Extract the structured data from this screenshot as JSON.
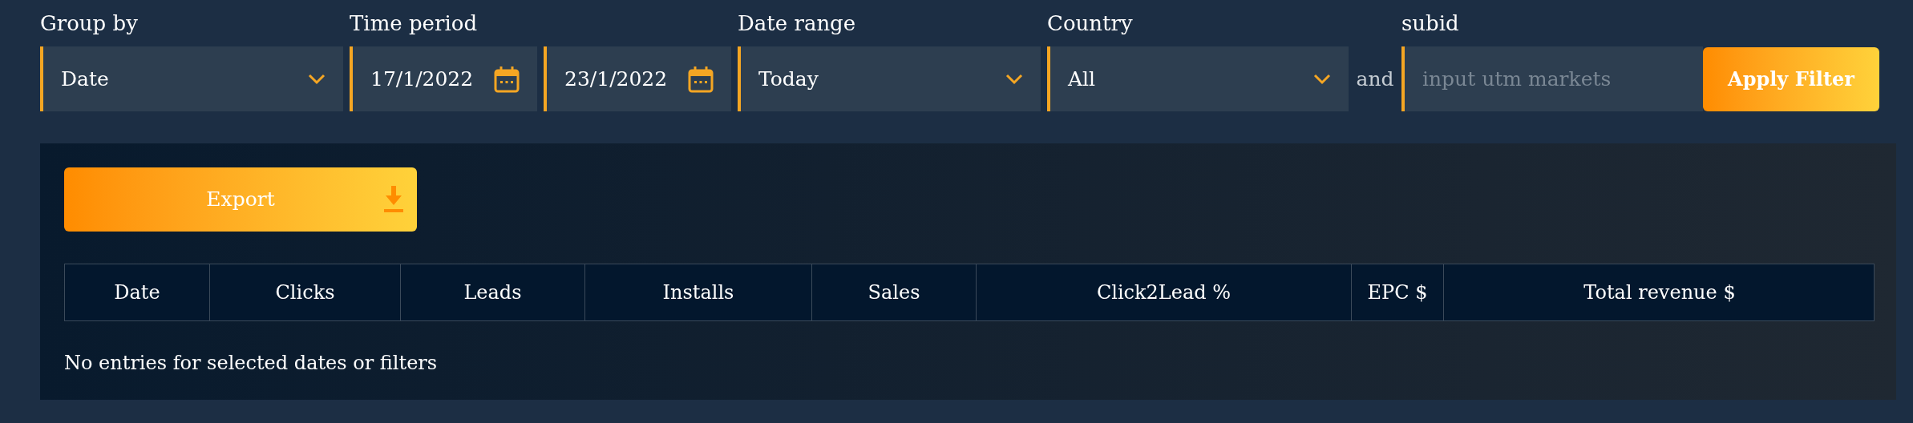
{
  "filters": [
    {
      "kind": "select",
      "label": "Group by",
      "value": "Date"
    },
    {
      "kind": "date",
      "label": "Time period",
      "value": "17/1/2022"
    },
    {
      "kind": "date",
      "value": "23/1/2022"
    },
    {
      "kind": "select",
      "label": "Date range",
      "value": "Today"
    },
    {
      "kind": "select",
      "label": "Country",
      "value": "All"
    },
    {
      "kind": "connector",
      "text": "and"
    },
    {
      "kind": "text",
      "label": "subid",
      "placeholder": "input utm markets"
    }
  ],
  "apply_button": "Apply Filter",
  "export_button": "Export",
  "table": {
    "columns": [
      "Date",
      "Clicks",
      "Leads",
      "Installs",
      "Sales",
      "Click2Lead %",
      "EPC $",
      "Total revenue $"
    ]
  },
  "empty_message": "No entries for selected dates or filters"
}
